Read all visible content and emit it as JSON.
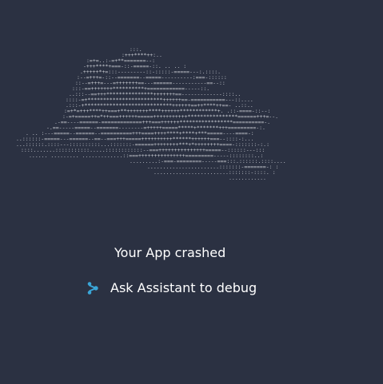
{
  "crash": {
    "illustration_icon": "cloud-ascii-art",
    "title": "Your App crashed"
  },
  "assistant": {
    "icon": "assistant-spark-icon",
    "label": "Ask Assistant to debug",
    "accent_color": "#3aa6d8"
  },
  "theme": {
    "background": "#2b3142",
    "text": "#ffffff",
    "art": "#c9ccd3"
  }
}
